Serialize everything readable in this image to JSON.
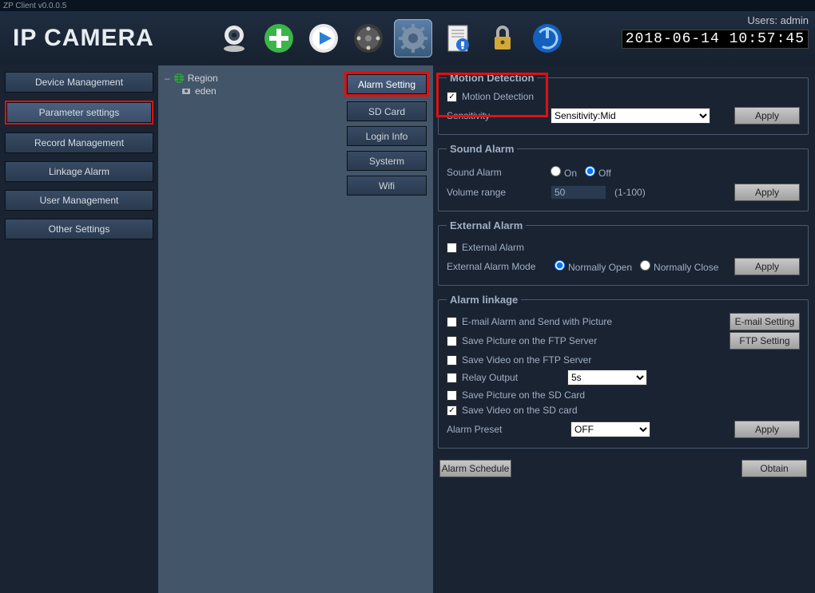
{
  "titlebar": "ZP Client v0.0.0.5",
  "logo": "IP CAMERA",
  "header": {
    "users_label": "Users: admin",
    "timestamp": "2018-06-14 10:57:45"
  },
  "left_nav": [
    "Device Management",
    "Parameter settings",
    "Record Management",
    "Linkage Alarm",
    "User Management",
    "Other Settings"
  ],
  "tree": {
    "root": "Region",
    "child": "eden"
  },
  "tabs": [
    "Alarm Setting",
    "SD Card",
    "Login Info",
    "Systerm",
    "Wifi"
  ],
  "motion": {
    "legend": "Motion Detection",
    "checkbox_label": "Motion Detection",
    "sensitivity_label": "Sensitivity",
    "sensitivity_value": "Sensitivity:Mid",
    "apply": "Apply"
  },
  "sound": {
    "legend": "Sound Alarm",
    "label": "Sound Alarm",
    "on": "On",
    "off": "Off",
    "volume_label": "Volume range",
    "volume_value": "50",
    "volume_range": "(1-100)",
    "apply": "Apply"
  },
  "external": {
    "legend": "External Alarm",
    "checkbox_label": "External Alarm",
    "mode_label": "External Alarm Mode",
    "open": "Normally Open",
    "close": "Normally Close",
    "apply": "Apply"
  },
  "linkage": {
    "legend": "Alarm linkage",
    "email": "E-mail Alarm and Send with Picture",
    "email_btn": "E-mail Setting",
    "ftp_pic": "Save Picture on the FTP Server",
    "ftp_btn": "FTP Setting",
    "ftp_vid": "Save Video on the FTP Server",
    "relay": "Relay Output",
    "relay_value": "5s",
    "sd_pic": "Save Picture on the SD Card",
    "sd_vid": "Save Video on the SD card",
    "preset_label": "Alarm Preset",
    "preset_value": "OFF",
    "apply": "Apply"
  },
  "bottom": {
    "schedule": "Alarm Schedule",
    "obtain": "Obtain"
  }
}
